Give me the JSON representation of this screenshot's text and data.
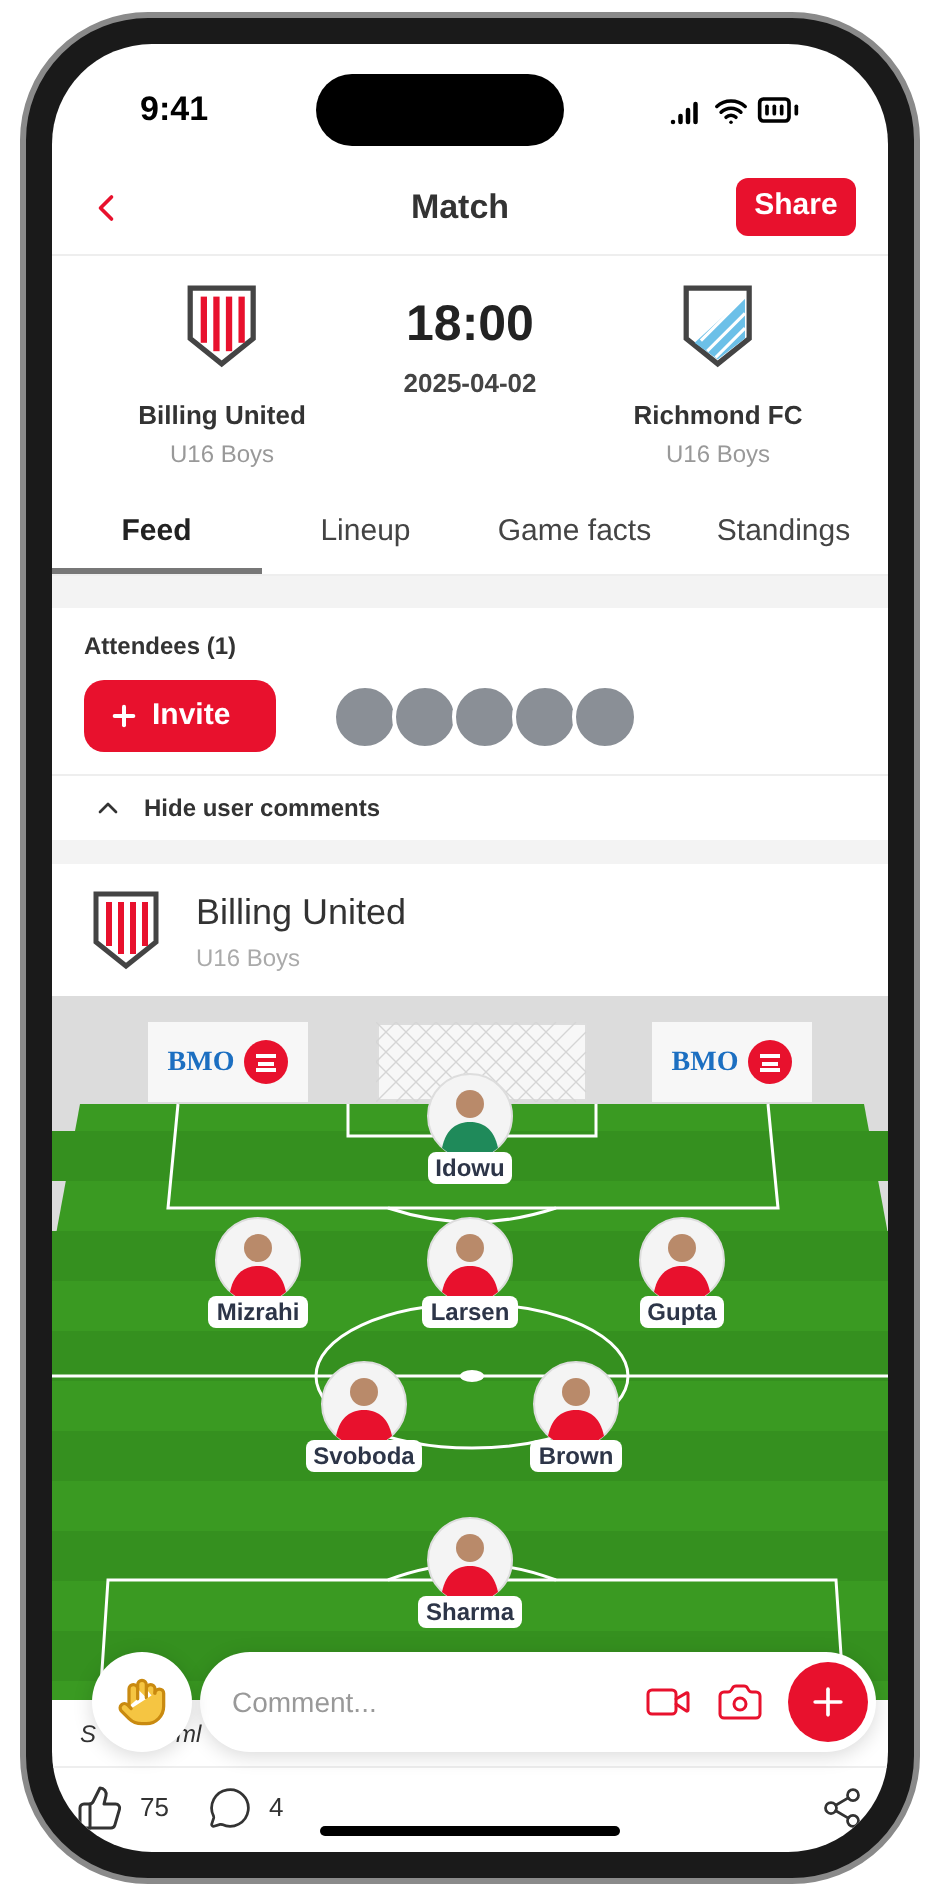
{
  "status_bar": {
    "time": "9:41"
  },
  "header": {
    "title": "Match",
    "share_button": "Share"
  },
  "match": {
    "home": {
      "name": "Billing United",
      "group": "U16 Boys",
      "kind": "stripes"
    },
    "time": "18:00",
    "date": "2025-04-02",
    "away": {
      "name": "Richmond FC",
      "group": "U16 Boys",
      "kind": "diagonal"
    }
  },
  "tabs": [
    {
      "label": "Feed",
      "selected": true
    },
    {
      "label": "Lineup",
      "selected": false
    },
    {
      "label": "Game facts",
      "selected": false
    },
    {
      "label": "Standings",
      "selected": false
    }
  ],
  "attendees": {
    "title": "Attendees (1)",
    "invite_button": "Invite",
    "avatars": [
      {
        "kind": "photo"
      },
      {
        "kind": "photo"
      },
      {
        "kind": "photo"
      },
      {
        "kind": "photo"
      },
      {
        "kind": "photo"
      }
    ]
  },
  "comments_toggle": {
    "label": "Hide user comments",
    "expanded": true
  },
  "lineup_card": {
    "team": "Billing United",
    "group": "U16 Boys",
    "kind": "stripes",
    "sponsor_boards": [
      "BMO",
      "BMO"
    ],
    "lines": [
      {
        "players": [
          {
            "name": "Idowu",
            "kind": "goalkeeper"
          }
        ]
      },
      {
        "players": [
          {
            "name": "Mizrahi",
            "kind": "outfield"
          },
          {
            "name": "Larsen",
            "kind": "outfield"
          },
          {
            "name": "Gupta",
            "kind": "outfield"
          }
        ]
      },
      {
        "players": [
          {
            "name": "Svoboda",
            "kind": "outfield"
          },
          {
            "name": "Brown",
            "kind": "outfield"
          }
        ]
      },
      {
        "players": [
          {
            "name": "Sharma",
            "kind": "outfield"
          }
        ]
      }
    ],
    "caption_fragments": [
      "S",
      "ml"
    ]
  },
  "comment_bar": {
    "placeholder": "Comment..."
  },
  "reactions": {
    "likes": "75",
    "comments": "4"
  }
}
